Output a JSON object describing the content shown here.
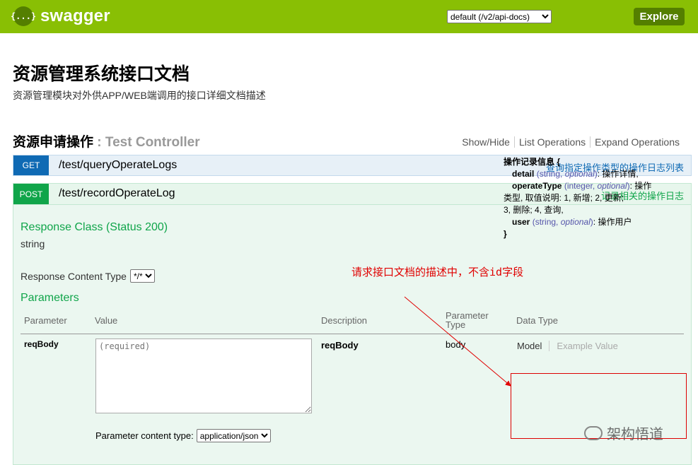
{
  "header": {
    "logo_icon": "{...}",
    "logo_text": "swagger",
    "spec_select": "default (/v2/api-docs)",
    "explore_label": "Explore",
    "bg_color": "#89bf04"
  },
  "info": {
    "title": "资源管理系统接口文档",
    "description": "资源管理模块对外供APP/WEB端调用的接口详细文档描述"
  },
  "resource": {
    "name": "资源申请操作",
    "separator": ":",
    "controller": "Test Controller",
    "ops": [
      "Show/Hide",
      "List Operations",
      "Expand Operations"
    ]
  },
  "operations": [
    {
      "method": "GET",
      "path": "/test/queryOperateLogs",
      "summary": "查询指定操作类型的操作日志列表"
    },
    {
      "method": "POST",
      "path": "/test/recordOperateLog",
      "summary": "记录相关的操作日志"
    }
  ],
  "post_body": {
    "response_class_title": "Response Class (Status 200)",
    "response_class_value": "string",
    "response_content_type_label": "Response Content Type",
    "response_content_type_value": "*/*",
    "parameters_title": "Parameters",
    "columns": [
      "Parameter",
      "Value",
      "Description",
      "Parameter Type",
      "Data Type"
    ],
    "param": {
      "name": "reqBody",
      "value_placeholder": "(required)",
      "description": "reqBody",
      "param_type": "body",
      "content_type_label": "Parameter content type:",
      "content_type_value": "application/json"
    },
    "model_tabs": [
      "Model",
      "Example Value"
    ],
    "model": {
      "name": "操作记录信息 {",
      "props": [
        {
          "name": "detail",
          "type": "string",
          "optional": "optional",
          "desc": "操作详情,"
        },
        {
          "name": "operateType",
          "type": "integer",
          "optional": "optional",
          "desc": "操作"
        },
        {
          "name": "",
          "type": "",
          "optional": "",
          "desc": "类型, 取值说明: 1, 新增; 2, 更新;"
        },
        {
          "name": "",
          "type": "",
          "optional": "",
          "desc": "3, 删除; 4, 查询,"
        },
        {
          "name": "user",
          "type": "string",
          "optional": "optional",
          "desc": "操作用户"
        }
      ],
      "close": "}"
    }
  },
  "annotation": {
    "note": "请求接口文档的描述中，不含id字段",
    "color": "#e00000"
  },
  "watermark": {
    "text": "架构悟道"
  }
}
